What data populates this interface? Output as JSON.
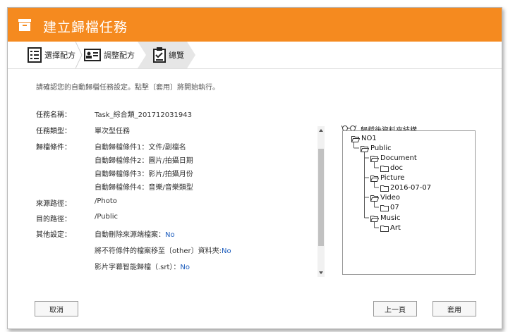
{
  "dialog": {
    "title": "建立歸檔任務",
    "title_icon": "archive-box-icon"
  },
  "steps": [
    {
      "label": "選擇配方",
      "icon": "list-document-icon",
      "active": false
    },
    {
      "label": "調整配方",
      "icon": "id-card-icon",
      "active": false
    },
    {
      "label": "總覽",
      "icon": "checklist-icon",
      "active": true
    }
  ],
  "intro": "請確認您的自動歸檔任務設定。點擊〔套用〕將開始執行。",
  "summary": {
    "task_name_label": "任務名稱：",
    "task_name_value": "Task_綜合類_201712031943",
    "task_type_label": "任務類型：",
    "task_type_value": "單次型任務",
    "conditions_label": "歸檔條件：",
    "conditions": [
      "自動歸檔條件1：文件/副檔名",
      "自動歸檔條件2：圖片/拍攝日期",
      "自動歸檔條件3：影片/拍攝月份",
      "自動歸檔條件4：音樂/音樂類型"
    ],
    "source_label": "來源路徑：",
    "source_value": "/Photo",
    "dest_label": "目的路徑：",
    "dest_value": "/Public",
    "other_label": "其他設定：",
    "other": [
      {
        "text": "自動刪除來源端檔案：",
        "value": "No"
      },
      {
        "text": "將不符條件的檔案移至〔other〕資料夾:",
        "value": "No"
      },
      {
        "text": "影片字幕智能歸檔（.srt）：",
        "value": "No"
      }
    ]
  },
  "tree": {
    "title": "歸檔後資料夾結構",
    "title_icon": "glasses-icon",
    "nodes": [
      {
        "label": "NO1",
        "depth": 0,
        "type": "open-folder"
      },
      {
        "label": "Public",
        "depth": 1,
        "type": "open-folder"
      },
      {
        "label": "Document",
        "depth": 2,
        "type": "open-folder"
      },
      {
        "label": "doc",
        "depth": 3,
        "type": "folder"
      },
      {
        "label": "Picture",
        "depth": 2,
        "type": "open-folder"
      },
      {
        "label": "2016-07-07",
        "depth": 3,
        "type": "folder"
      },
      {
        "label": "Video",
        "depth": 2,
        "type": "open-folder"
      },
      {
        "label": "07",
        "depth": 3,
        "type": "folder"
      },
      {
        "label": "Music",
        "depth": 2,
        "type": "open-folder"
      },
      {
        "label": "Art",
        "depth": 3,
        "type": "folder"
      }
    ]
  },
  "buttons": {
    "cancel": "取消",
    "back": "上一頁",
    "apply": "套用"
  },
  "colors": {
    "title_bar": "#f58a1f",
    "value_blue": "#1a5bbd",
    "step_active_bg": "#e6e6e6"
  }
}
